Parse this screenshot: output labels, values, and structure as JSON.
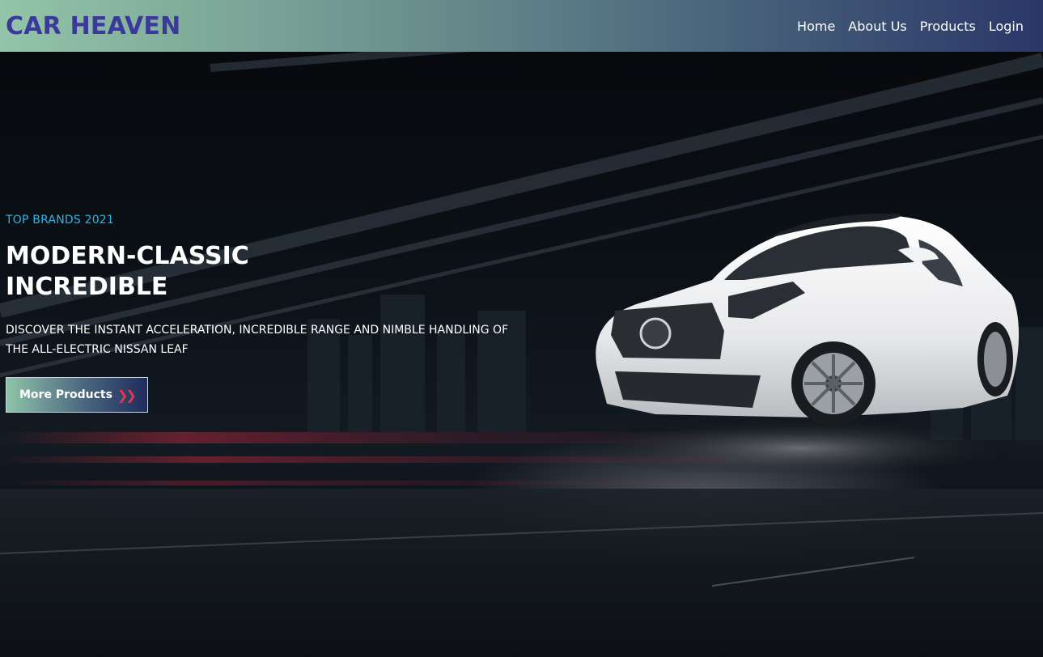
{
  "header": {
    "brand": "CAR HEAVEN",
    "nav": [
      "Home",
      "About Us",
      "Products",
      "Login"
    ]
  },
  "hero": {
    "tagline": "TOP BRANDS 2021",
    "headline": "MODERN-CLASSIC INCREDIBLE",
    "description": "DISCOVER THE INSTANT ACCELERATION, INCREDIBLE RANGE AND NIMBLE HANDLING OF THE ALL-ELECTRIC NISSAN LEAF",
    "button_label": "More Products",
    "button_icon": "double-chevron-right-icon",
    "image": "white-sports-car"
  },
  "colors": {
    "brand": "#3b3a9a",
    "tagline": "#2fb3e6",
    "accent_icon": "#e8364d",
    "nav_gradient": [
      "#93c4a8",
      "#2a3768"
    ]
  }
}
